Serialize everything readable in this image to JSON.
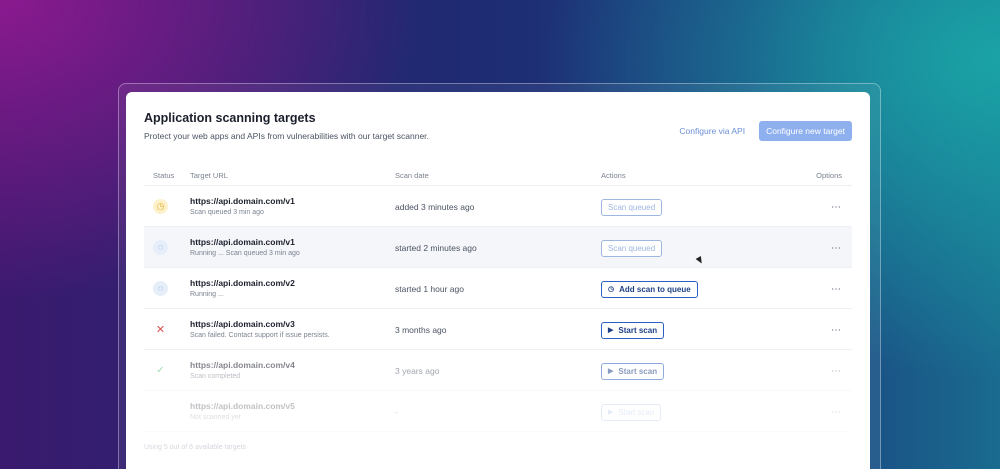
{
  "header": {
    "title": "Application scanning targets",
    "subtitle": "Protect your web apps and APIs from vulnerabilities with our target scanner.",
    "configure_api_label": "Configure via API",
    "configure_new_label": "Configure new target"
  },
  "table": {
    "columns": [
      "Status",
      "Target URL",
      "Scan date",
      "Actions",
      "Options"
    ],
    "rows": [
      {
        "status_icon": "clock-icon",
        "status_glyph": "◷",
        "url": "https://api.domain.com/v1",
        "sub": "Scan queued 3 min ago",
        "date": "added 3 minutes ago",
        "action_icon": "",
        "action": "Scan queued",
        "options": "⋯"
      },
      {
        "status_icon": "spinner-icon",
        "status_glyph": "◌",
        "url": "https://api.domain.com/v1",
        "sub": "Running ... Scan queued 3 min ago",
        "date": "started 2 minutes ago",
        "action_icon": "",
        "action": "Scan queued",
        "options": "⋯"
      },
      {
        "status_icon": "spinner-icon",
        "status_glyph": "◌",
        "url": "https://api.domain.com/v2",
        "sub": "Running ...",
        "date": "started 1 hour ago",
        "action_icon": "◷",
        "action": "Add scan to queue",
        "options": "⋯"
      },
      {
        "status_icon": "x-icon",
        "status_glyph": "✕",
        "url": "https://api.domain.com/v3",
        "sub": "Scan failed. Contact support if issue persists.",
        "date": "3 months ago",
        "action_icon": "▶",
        "action": "Start scan",
        "options": "⋯"
      },
      {
        "status_icon": "check-icon",
        "status_glyph": "✓",
        "url": "https://api.domain.com/v4",
        "sub": "Scan completed",
        "date": "3 years ago",
        "action_icon": "▶",
        "action": "Start scan",
        "options": "⋯"
      },
      {
        "status_icon": "circle-icon",
        "status_glyph": "◌",
        "url": "https://api.domain.com/v5",
        "sub": "Not scanned yet",
        "date": "-",
        "action_icon": "▶",
        "action": "Start scan",
        "options": "⋯"
      }
    ]
  },
  "footer": {
    "text": "Using 5 out of 6 available targets"
  },
  "colors": {
    "primary": "#8fb0ef",
    "accent": "#2c5fc0",
    "danger": "#d9534f",
    "success": "#52b86a",
    "warning": "#e0b034"
  }
}
